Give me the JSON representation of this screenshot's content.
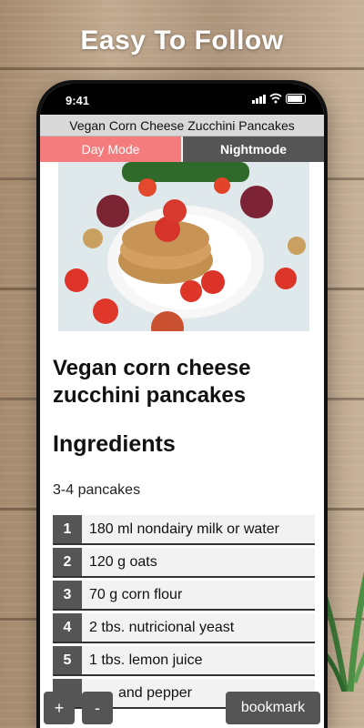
{
  "promo": {
    "title": "Easy To Follow"
  },
  "status": {
    "time": "9:41"
  },
  "app": {
    "title": "Vegan Corn Cheese Zucchini Pancakes"
  },
  "modes": {
    "day": "Day Mode",
    "night": "Nightmode"
  },
  "recipe": {
    "heading": "Vegan corn cheese zucchini pancakes",
    "ingredients_heading": "Ingredients",
    "servings": "3-4 pancakes",
    "ingredients": [
      {
        "num": "1",
        "text": "180 ml nondairy milk or water"
      },
      {
        "num": "2",
        "text": "120 g oats"
      },
      {
        "num": "3",
        "text": "70 g corn flour"
      },
      {
        "num": "4",
        "text": "2 tbs. nutricional yeast"
      },
      {
        "num": "5",
        "text": "1 tbs. lemon juice"
      },
      {
        "num": "",
        "text": "and pepper"
      }
    ]
  },
  "controls": {
    "plus": "+",
    "minus": "-",
    "bookmark": "bookmark"
  },
  "colors": {
    "day_tab": "#f47c7c",
    "night_tab": "#555555"
  }
}
